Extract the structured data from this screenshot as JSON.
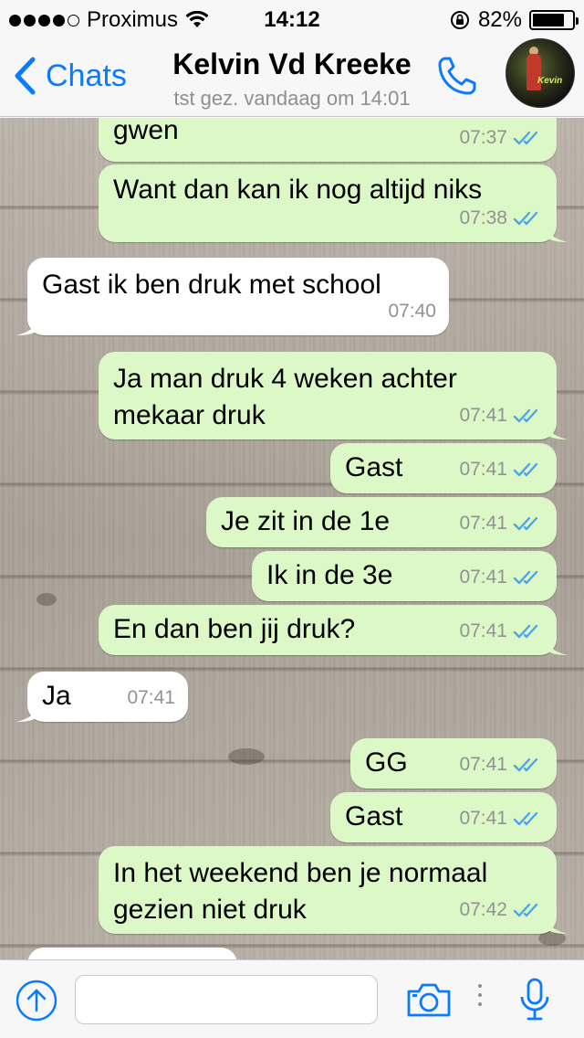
{
  "status_bar": {
    "carrier": "Proximus",
    "time": "14:12",
    "battery": "82%",
    "battery_level": 0.82
  },
  "header": {
    "back_label": "Chats",
    "contact_name": "Kelvin Vd Kreeke",
    "last_seen": "tst gez. vandaag om 14:01",
    "icons": [
      "chevron-left-icon",
      "phone-icon",
      "avatar"
    ]
  },
  "messages": [
    {
      "dir": "out",
      "text": "gwen",
      "time": "07:37",
      "read": true
    },
    {
      "dir": "out",
      "text": "Want dan kan ik nog altijd niks",
      "time": "07:38",
      "read": true
    },
    {
      "dir": "in",
      "text": "Gast ik ben druk met school",
      "time": "07:40"
    },
    {
      "dir": "out",
      "text": "Ja man druk 4 weken achter mekaar druk",
      "time": "07:41",
      "read": true
    },
    {
      "dir": "out",
      "text": "Gast",
      "time": "07:41",
      "read": true
    },
    {
      "dir": "out",
      "text": "Je zit in de 1e",
      "time": "07:41",
      "read": true
    },
    {
      "dir": "out",
      "text": "Ik in de 3e",
      "time": "07:41",
      "read": true
    },
    {
      "dir": "out",
      "text": "En dan ben jij druk?",
      "time": "07:41",
      "read": true
    },
    {
      "dir": "in",
      "text": "Ja",
      "time": "07:41"
    },
    {
      "dir": "out",
      "text": "GG",
      "time": "07:41",
      "read": true
    },
    {
      "dir": "out",
      "text": "Gast",
      "time": "07:41",
      "read": true
    },
    {
      "dir": "out",
      "text": "In het weekend ben je normaal gezien niet druk",
      "time": "07:42",
      "read": true
    }
  ],
  "input_bar": {
    "placeholder": "",
    "icons": [
      "upload-icon",
      "camera-icon",
      "more-icon",
      "microphone-icon"
    ]
  },
  "colors": {
    "accent": "#0a7aff",
    "outgoing_bubble": "#dcf8c6",
    "incoming_bubble": "#ffffff",
    "read_ticks": "#4fa3e6"
  }
}
